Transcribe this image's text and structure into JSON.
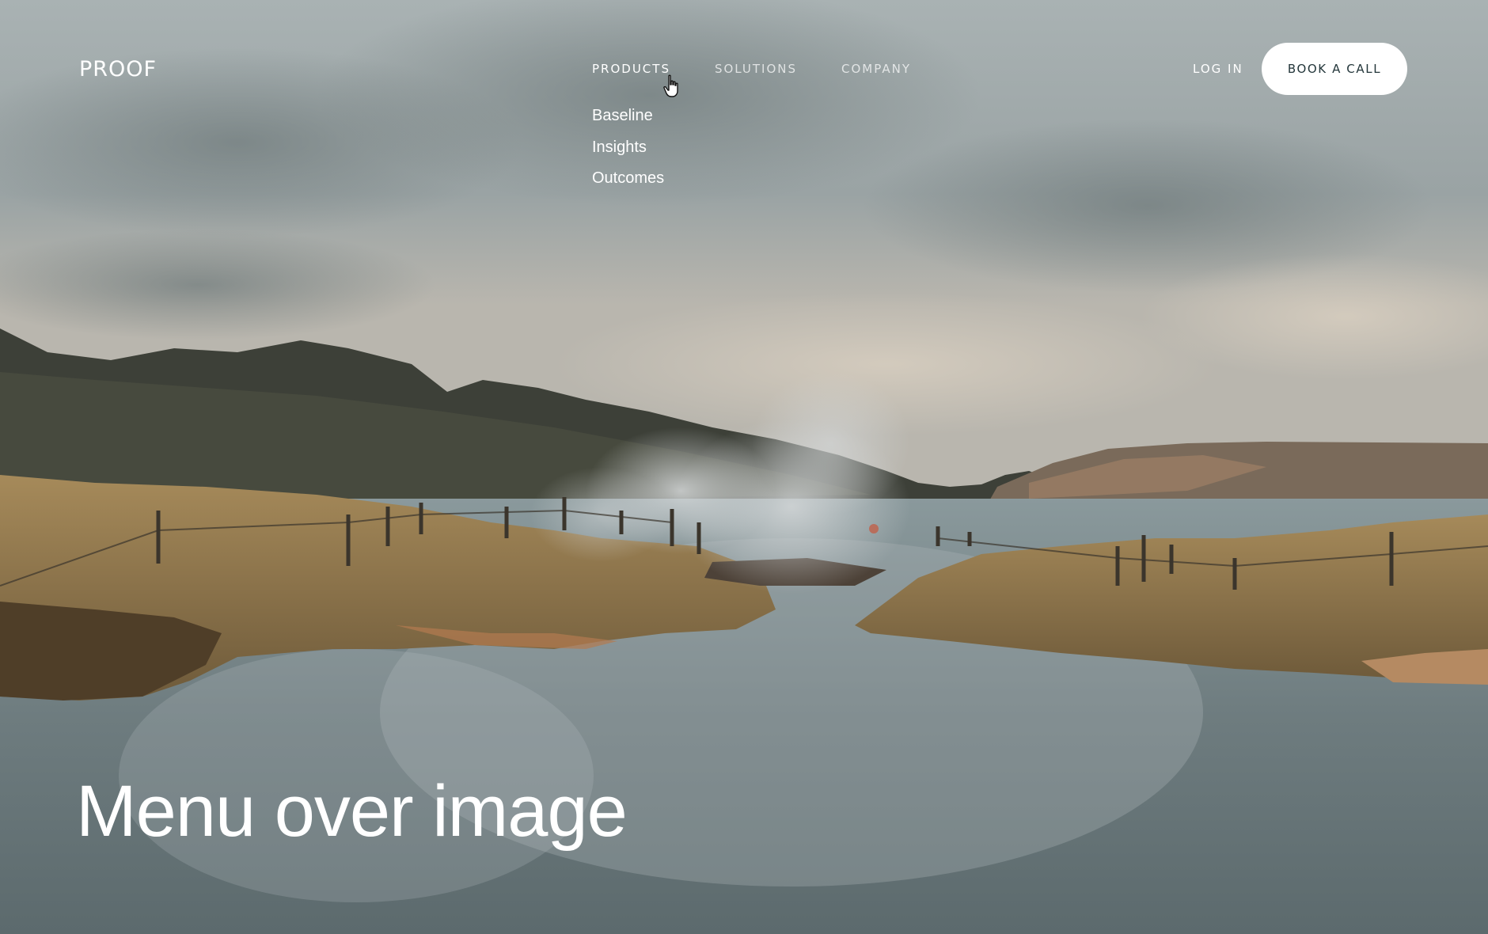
{
  "header": {
    "logo_text": "PROOF"
  },
  "nav": {
    "items": [
      {
        "label": "PRODUCTS",
        "active": true
      },
      {
        "label": "SOLUTIONS",
        "active": false
      },
      {
        "label": "COMPANY",
        "active": false
      }
    ],
    "products_menu": [
      "Baseline",
      "Insights",
      "Outcomes"
    ],
    "login_label": "LOG IN",
    "cta_label": "BOOK A CALL"
  },
  "hero": {
    "title": "Menu over image"
  },
  "colors": {
    "cta_text": "#23363a",
    "cta_background": "#ffffff",
    "nav_text": "#ffffff"
  },
  "icons": {
    "cursor": "hand-pointer-icon"
  }
}
